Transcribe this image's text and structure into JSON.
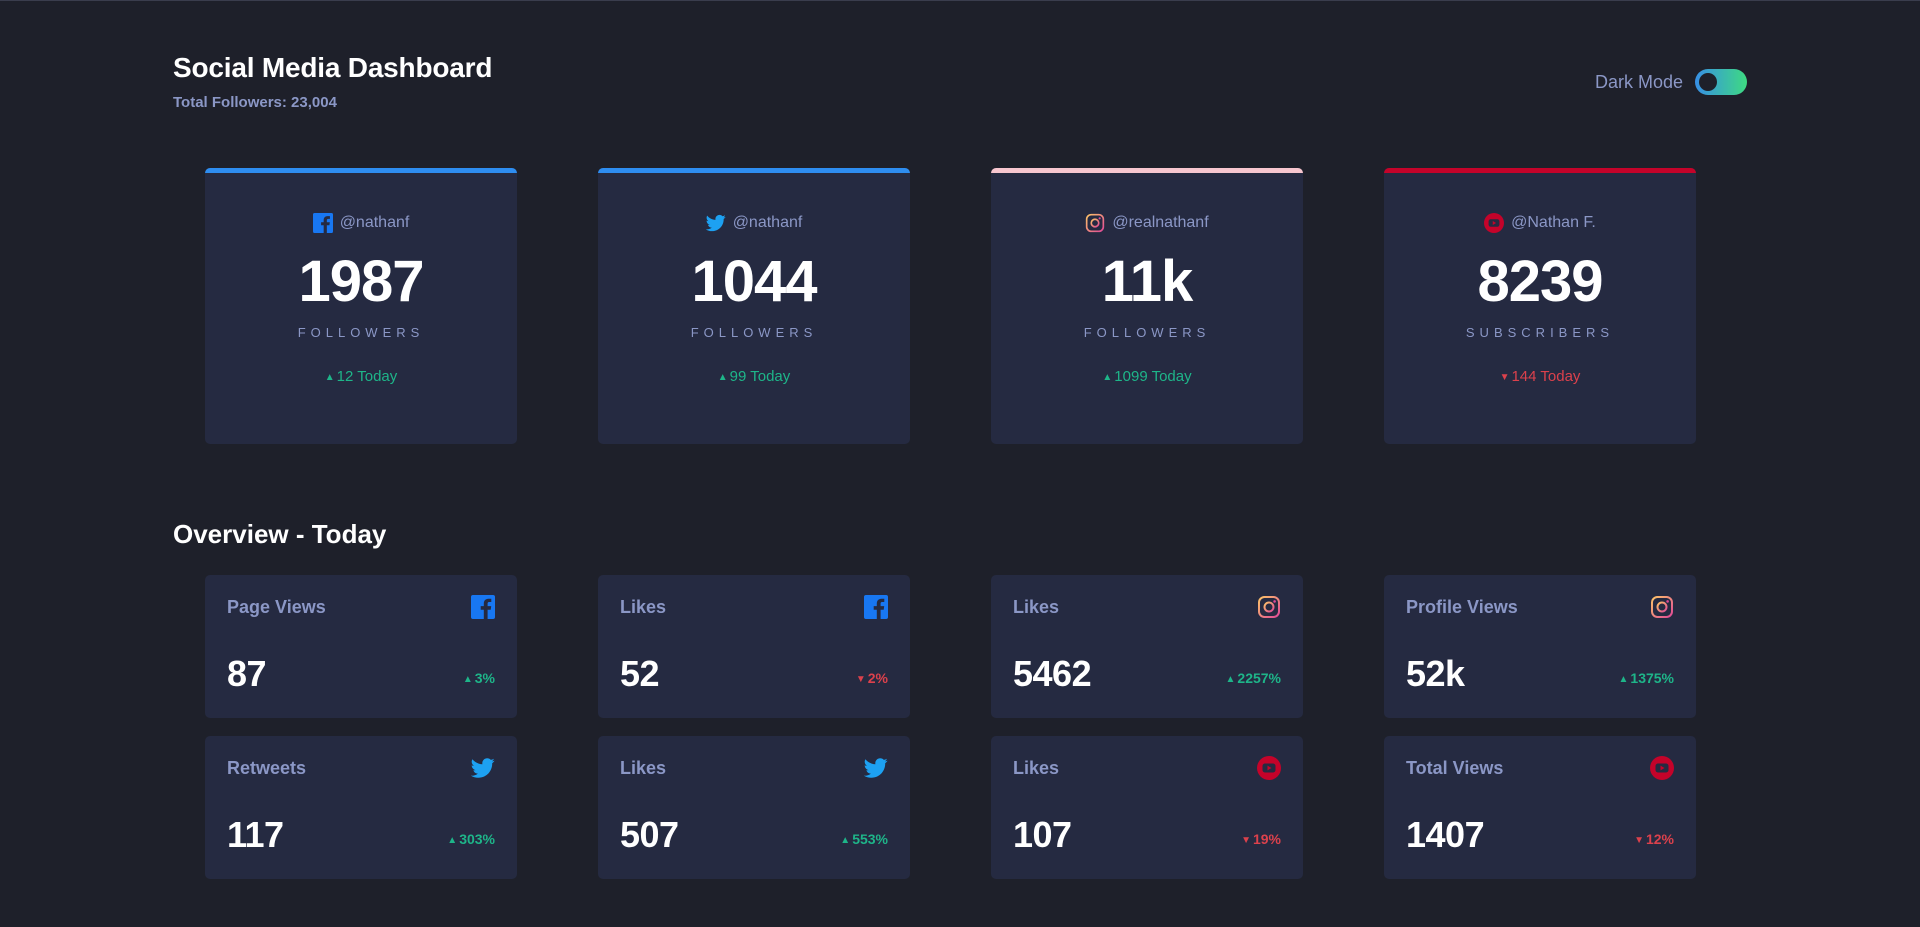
{
  "header": {
    "title": "Social Media Dashboard",
    "subtitle": "Total Followers: 23,004",
    "toggle_label": "Dark Mode"
  },
  "colors": {
    "facebook": "#1877f2",
    "twitter": "#1da1f2",
    "instagram_start": "#fdc468",
    "instagram_end": "#df4996",
    "youtube": "#c4032a",
    "up": "#1eb589",
    "down": "#dc414c"
  },
  "followers": [
    {
      "network": "facebook",
      "icon": "facebook-icon",
      "handle": "@nathanf",
      "count": "1987",
      "metric": "FOLLOWERS",
      "arrow": "▲",
      "trend": "up",
      "today": "12 Today",
      "bar_color": "#2e8df0"
    },
    {
      "network": "twitter",
      "icon": "twitter-icon",
      "handle": "@nathanf",
      "count": "1044",
      "metric": "FOLLOWERS",
      "arrow": "▲",
      "trend": "up",
      "today": "99 Today",
      "bar_color": "#2e8df0"
    },
    {
      "network": "instagram",
      "icon": "instagram-icon",
      "handle": "@realnathanf",
      "count": "11k",
      "metric": "FOLLOWERS",
      "arrow": "▲",
      "trend": "up",
      "today": "1099 Today",
      "bar_color": "#f7c6cf"
    },
    {
      "network": "youtube",
      "icon": "youtube-icon",
      "handle": "@Nathan F.",
      "count": "8239",
      "metric": "SUBSCRIBERS",
      "arrow": "▼",
      "trend": "down",
      "today": "144 Today",
      "bar_color": "#c4032a"
    }
  ],
  "overview": {
    "title": "Overview - Today",
    "cards": [
      {
        "label": "Page Views",
        "network": "facebook",
        "icon": "facebook-icon",
        "value": "87",
        "arrow": "▲",
        "trend": "up",
        "change": "3%"
      },
      {
        "label": "Likes",
        "network": "facebook",
        "icon": "facebook-icon",
        "value": "52",
        "arrow": "▼",
        "trend": "down",
        "change": "2%"
      },
      {
        "label": "Likes",
        "network": "instagram",
        "icon": "instagram-icon",
        "value": "5462",
        "arrow": "▲",
        "trend": "up",
        "change": "2257%"
      },
      {
        "label": "Profile Views",
        "network": "instagram",
        "icon": "instagram-icon",
        "value": "52k",
        "arrow": "▲",
        "trend": "up",
        "change": "1375%"
      },
      {
        "label": "Retweets",
        "network": "twitter",
        "icon": "twitter-icon",
        "value": "117",
        "arrow": "▲",
        "trend": "up",
        "change": "303%"
      },
      {
        "label": "Likes",
        "network": "twitter",
        "icon": "twitter-icon",
        "value": "507",
        "arrow": "▲",
        "trend": "up",
        "change": "553%"
      },
      {
        "label": "Likes",
        "network": "youtube",
        "icon": "youtube-icon",
        "value": "107",
        "arrow": "▼",
        "trend": "down",
        "change": "19%"
      },
      {
        "label": "Total Views",
        "network": "youtube",
        "icon": "youtube-icon",
        "value": "1407",
        "arrow": "▼",
        "trend": "down",
        "change": "12%"
      }
    ]
  }
}
